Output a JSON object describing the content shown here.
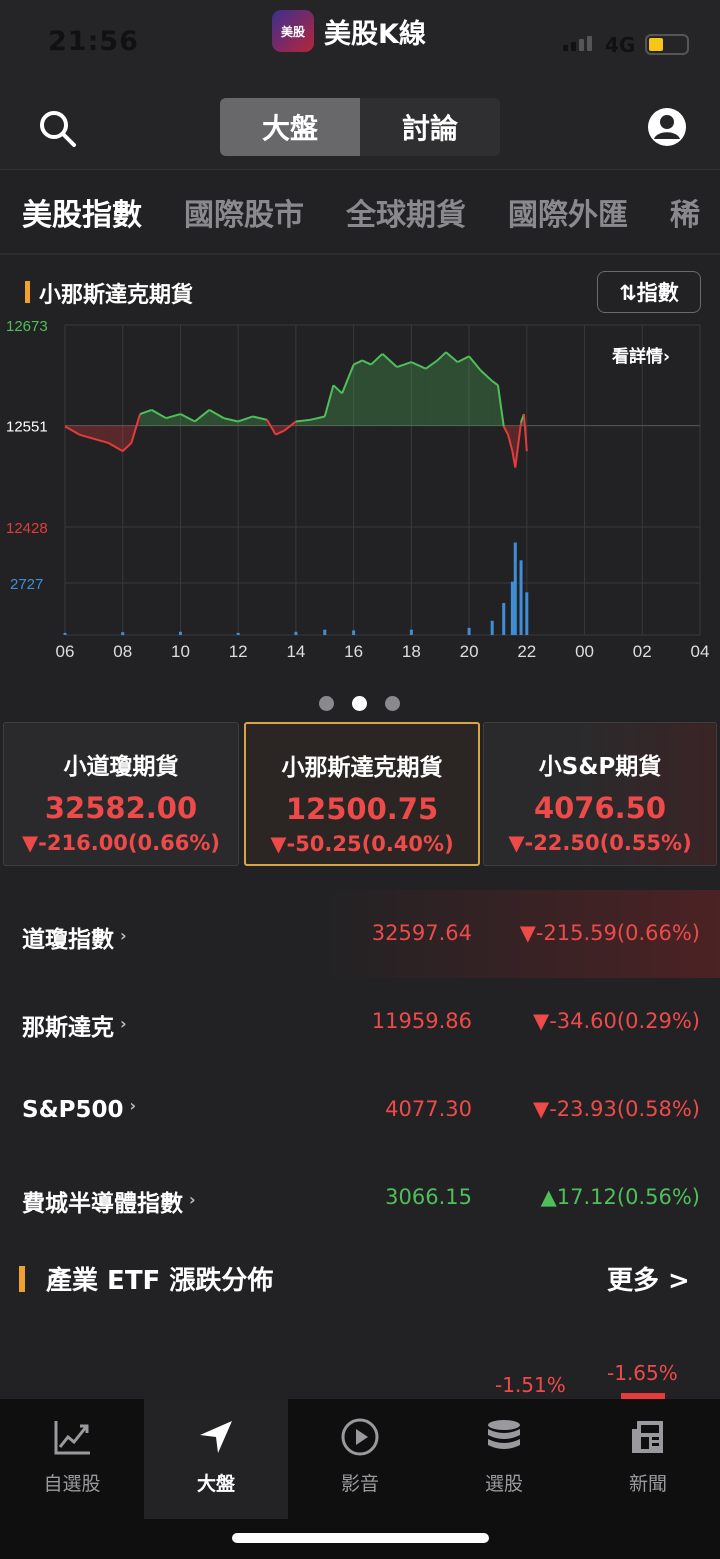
{
  "status": {
    "time": "21:56",
    "network": "4G"
  },
  "app": {
    "logo_text": "美股",
    "title": "美股K線"
  },
  "nav": {
    "segments": [
      "大盤",
      "討論"
    ]
  },
  "category_tabs": [
    "美股指數",
    "國際股市",
    "全球期貨",
    "國際外匯",
    "稀"
  ],
  "chart": {
    "title": "小那斯達克期貨",
    "toggle_label": "⇅指數",
    "detail_link": "看詳情",
    "colors": {
      "up": "#4fbf5a",
      "down": "#e53b3b",
      "volume": "#3f8fd8",
      "grid": "#3a3a3d"
    }
  },
  "chart_data": {
    "type": "area",
    "title": "小那斯達克期貨",
    "y_tick_labels": [
      "12673",
      "12551",
      "12428"
    ],
    "ylim": [
      12428,
      12673
    ],
    "baseline": 12551,
    "volume_tick_label": "2727",
    "volume_ylim": [
      0,
      2727
    ],
    "x_tick_labels": [
      "06",
      "08",
      "10",
      "12",
      "14",
      "16",
      "18",
      "20",
      "22",
      "00",
      "02",
      "04"
    ],
    "x_range_hours": [
      6,
      28
    ],
    "series": [
      {
        "x": [
          6.0,
          6.5,
          7.0,
          7.5,
          8.0,
          8.3,
          8.6,
          9.0,
          9.5,
          10.0,
          10.5,
          11.0,
          11.5,
          12.0,
          12.5,
          13.0,
          13.3,
          13.6,
          14.0,
          14.5,
          15.0,
          15.3,
          15.6,
          16.0,
          16.3,
          16.6,
          17.0,
          17.5,
          18.0,
          18.5,
          18.9,
          19.2,
          19.6,
          20.0,
          20.4,
          20.8,
          21.0,
          21.2,
          21.35,
          21.5,
          21.6,
          21.8,
          21.9,
          22.0
        ],
        "values": [
          12550,
          12540,
          12535,
          12530,
          12520,
          12530,
          12565,
          12570,
          12560,
          12565,
          12556,
          12570,
          12560,
          12556,
          12562,
          12558,
          12540,
          12545,
          12556,
          12558,
          12562,
          12600,
          12590,
          12625,
          12630,
          12625,
          12638,
          12622,
          12628,
          12620,
          12630,
          12640,
          12628,
          12635,
          12618,
          12605,
          12600,
          12550,
          12540,
          12520,
          12500,
          12555,
          12565,
          12520
        ]
      }
    ],
    "volume": {
      "x": [
        6,
        8,
        10,
        12,
        14,
        15,
        16,
        18,
        20,
        20.8,
        21.2,
        21.5,
        21.6,
        21.8,
        22.0
      ],
      "values": [
        60,
        80,
        90,
        60,
        90,
        150,
        130,
        150,
        200,
        400,
        900,
        1500,
        2600,
        2100,
        1200
      ]
    }
  },
  "pager": {
    "count": 3,
    "active": 1
  },
  "futures": [
    {
      "name": "小道瓊期貨",
      "price": "32582.00",
      "change": "▼-216.00(0.66%)"
    },
    {
      "name": "小那斯達克期貨",
      "price": "12500.75",
      "change": "▼-50.25(0.40%)"
    },
    {
      "name": "小S&P期貨",
      "price": "4076.50",
      "change": "▼-22.50(0.55%)"
    }
  ],
  "indices": [
    {
      "name": "道瓊指數",
      "value": "32597.64",
      "change": "▼-215.59(0.66%)",
      "direction": "down"
    },
    {
      "name": "那斯達克",
      "value": "11959.86",
      "change": "▼-34.60(0.29%)",
      "direction": "down"
    },
    {
      "name": "S&P500",
      "value": "4077.30",
      "change": "▼-23.93(0.58%)",
      "direction": "down"
    },
    {
      "name": "費城半導體指數",
      "value": "3066.15",
      "change": "▲17.12(0.56%)",
      "direction": "up"
    }
  ],
  "etf": {
    "title": "產業 ETF 漲跌分佈",
    "more": "更多 >",
    "values": [
      "-1.51%",
      "-1.65%"
    ]
  },
  "tabbar": [
    {
      "label": "自選股",
      "icon": "chart-line-icon"
    },
    {
      "label": "大盤",
      "icon": "navigation-arrow-icon"
    },
    {
      "label": "影音",
      "icon": "play-circle-icon"
    },
    {
      "label": "選股",
      "icon": "database-stack-icon"
    },
    {
      "label": "新聞",
      "icon": "newspaper-icon"
    }
  ]
}
